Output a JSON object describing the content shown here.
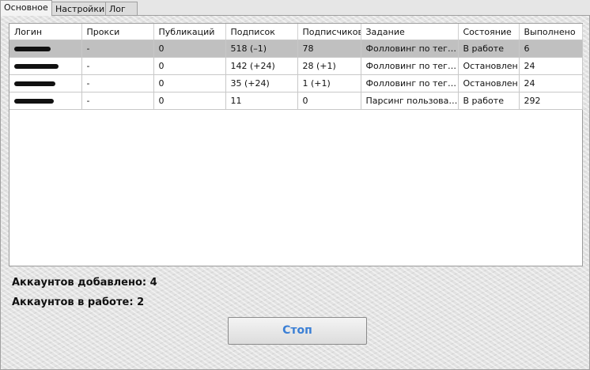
{
  "tabs": [
    "Основное",
    "Настройки",
    "Лог"
  ],
  "table": {
    "columns": [
      "Логин",
      "Прокси",
      "Публикаций",
      "Подписок",
      "Подписчиков",
      "Задание",
      "Состояние",
      "Выполнено"
    ],
    "rows": [
      {
        "login": "",
        "proxy": "-",
        "posts": "0",
        "following": "518 (–1)",
        "followers": "78",
        "task": "Фолловинг по тегам",
        "state": "В работе",
        "done": "6",
        "selected": true
      },
      {
        "login": "",
        "proxy": "-",
        "posts": "0",
        "following": "142 (+24)",
        "followers": "28 (+1)",
        "task": "Фолловинг по тегам",
        "state": "Остановлен",
        "done": "24",
        "selected": false
      },
      {
        "login": "",
        "proxy": "-",
        "posts": "0",
        "following": "35 (+24)",
        "followers": "1 (+1)",
        "task": "Фолловинг по тегам",
        "state": "Остановлен",
        "done": "24",
        "selected": false
      },
      {
        "login": "",
        "proxy": "-",
        "posts": "0",
        "following": "11",
        "followers": "0",
        "task": "Парсинг пользовате...",
        "state": "В работе",
        "done": "292",
        "selected": false
      }
    ]
  },
  "stats": {
    "accounts_added": "Аккаунтов добавлено: 4",
    "accounts_active": "Аккаунтов в работе: 2"
  },
  "stop_button": "Стоп",
  "colors": {
    "selected_row": "#c0c0c0",
    "button_text": "#3a7fd5"
  }
}
